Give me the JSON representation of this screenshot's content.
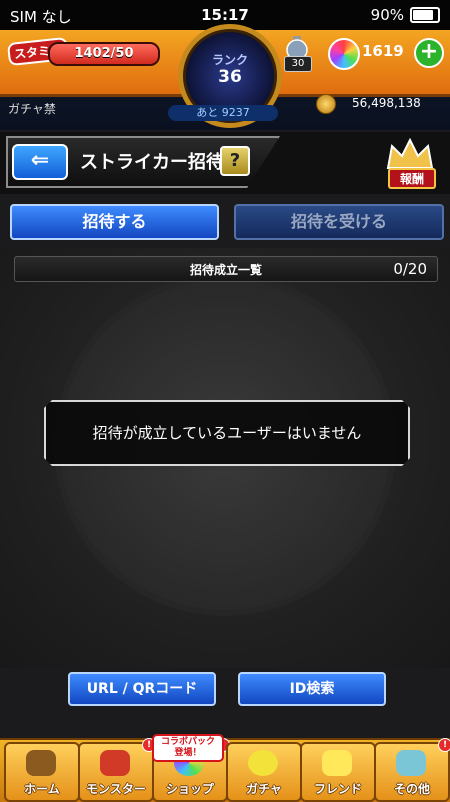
{
  "status_bar": {
    "carrier": "SIM なし",
    "time": "15:17",
    "battery": "90%"
  },
  "header": {
    "stamina_label": "スタミナ",
    "stamina_value": "1402/50",
    "stamina_fraction": 1.0,
    "rank_label": "ランク",
    "rank_value": "36",
    "item_count": "30",
    "orb_count": "1619",
    "plus_label": "+",
    "gacha_ban": "ガチャ禁",
    "next_rank": "あと 9237",
    "gold": "56,498,138"
  },
  "title_bar": {
    "back_label": "⇐",
    "title": "ストライカー招待",
    "help_label": "?",
    "reward_label": "報酬"
  },
  "tabs": {
    "invite": "招待する",
    "receive": "招待を受ける"
  },
  "list": {
    "header": "招待成立一覧",
    "count": "0/20",
    "empty_message": "招待が成立しているユーザーはいません"
  },
  "actions": {
    "url_qr": "URL / QRコード",
    "id_search": "ID検索"
  },
  "nav": {
    "collab_badge": "コラボパック登場！",
    "items": [
      {
        "label": "ホーム"
      },
      {
        "label": "モンスター"
      },
      {
        "label": "ショップ"
      },
      {
        "label": "ガチャ"
      },
      {
        "label": "フレンド"
      },
      {
        "label": "その他"
      }
    ]
  },
  "colors": {
    "accent_blue": "#1e64e0",
    "header_orange": "#e9901a",
    "alert_red": "#e52a2a"
  }
}
